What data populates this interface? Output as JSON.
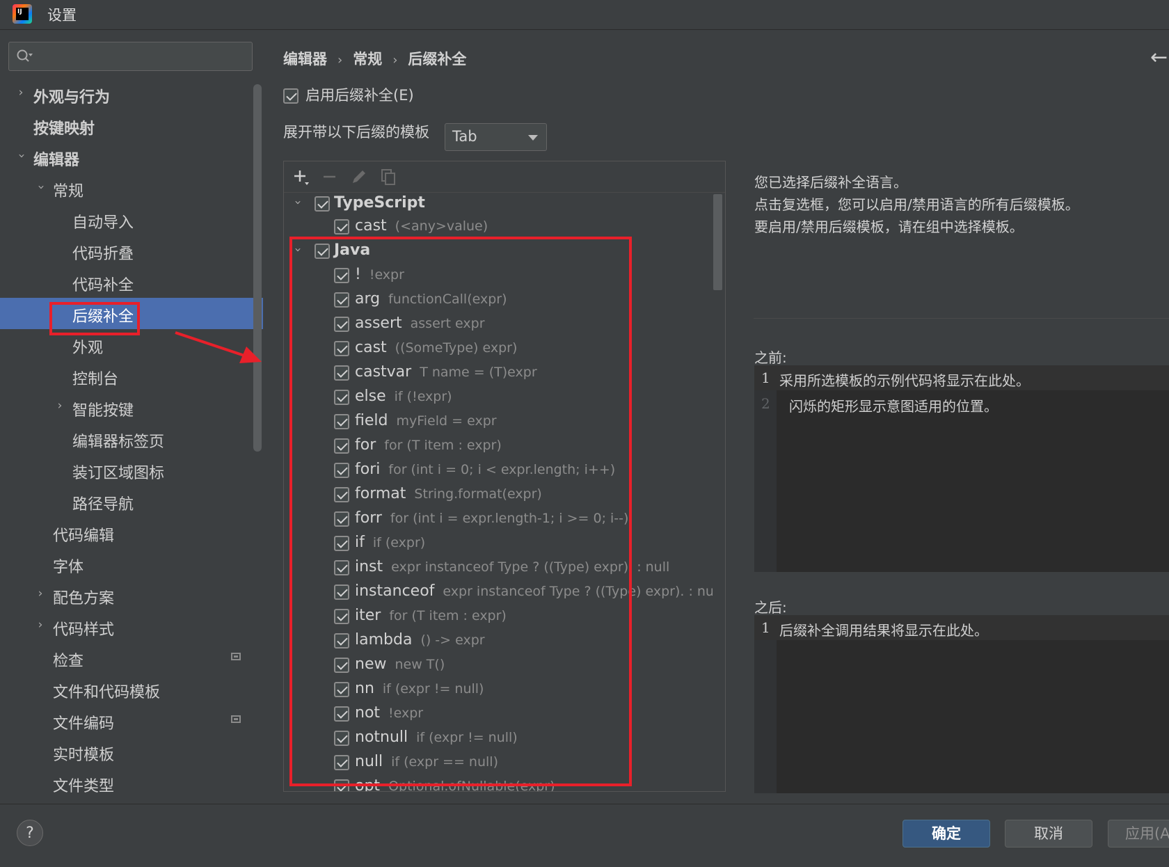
{
  "window": {
    "title": "设置"
  },
  "search": {
    "placeholder": ""
  },
  "sidebar": {
    "items": [
      {
        "label": "外观与行为"
      },
      {
        "label": "按键映射"
      },
      {
        "label": "编辑器"
      },
      {
        "label": "常规"
      },
      {
        "label": "自动导入"
      },
      {
        "label": "代码折叠"
      },
      {
        "label": "代码补全"
      },
      {
        "label": "后缀补全"
      },
      {
        "label": "外观"
      },
      {
        "label": "控制台"
      },
      {
        "label": "智能按键"
      },
      {
        "label": "编辑器标签页"
      },
      {
        "label": "装订区域图标"
      },
      {
        "label": "路径导航"
      },
      {
        "label": "代码编辑"
      },
      {
        "label": "字体"
      },
      {
        "label": "配色方案"
      },
      {
        "label": "代码样式"
      },
      {
        "label": "检查"
      },
      {
        "label": "文件和代码模板"
      },
      {
        "label": "文件编码"
      },
      {
        "label": "实时模板"
      },
      {
        "label": "文件类型"
      }
    ]
  },
  "breadcrumb": {
    "items": [
      "编辑器",
      "常规",
      "后缀补全"
    ]
  },
  "main": {
    "enable_label": "启用后缀补全(E)",
    "expand_label": "展开带以下后缀的模板",
    "expand_value": "Tab"
  },
  "templates": {
    "groups": [
      {
        "name": "TypeScript",
        "items": [
          {
            "key": "cast",
            "example": "(<any>value)"
          }
        ]
      },
      {
        "name": "Java",
        "items": [
          {
            "key": "!",
            "example": "!expr"
          },
          {
            "key": "arg",
            "example": "functionCall(expr)"
          },
          {
            "key": "assert",
            "example": "assert expr"
          },
          {
            "key": "cast",
            "example": "((SomeType) expr)"
          },
          {
            "key": "castvar",
            "example": "T name = (T)expr"
          },
          {
            "key": "else",
            "example": "if (!expr)"
          },
          {
            "key": "field",
            "example": "myField = expr"
          },
          {
            "key": "for",
            "example": "for (T item : expr)"
          },
          {
            "key": "fori",
            "example": "for (int i = 0; i < expr.length; i++)"
          },
          {
            "key": "format",
            "example": "String.format(expr)"
          },
          {
            "key": "forr",
            "example": "for (int i = expr.length-1; i >= 0; i--)"
          },
          {
            "key": "if",
            "example": "if (expr)"
          },
          {
            "key": "inst",
            "example": "expr instanceof Type ? ((Type) expr). : null"
          },
          {
            "key": "instanceof",
            "example": "expr instanceof Type ? ((Type) expr). : null"
          },
          {
            "key": "iter",
            "example": "for (T item : expr)"
          },
          {
            "key": "lambda",
            "example": "() -> expr"
          },
          {
            "key": "new",
            "example": "new T()"
          },
          {
            "key": "nn",
            "example": "if (expr != null)"
          },
          {
            "key": "not",
            "example": "!expr"
          },
          {
            "key": "notnull",
            "example": "if (expr != null)"
          },
          {
            "key": "null",
            "example": "if (expr == null)"
          },
          {
            "key": "opt",
            "example": "Optional.ofNullable(expr)"
          }
        ]
      }
    ]
  },
  "description": {
    "lines": [
      "您已选择后缀补全语言。",
      "点击复选框，您可以启用/禁用语言的所有后缀模板。",
      "要启用/禁用后缀模板，请在组中选择模板。"
    ]
  },
  "before": {
    "label": "之前:",
    "lines": [
      {
        "num": "1",
        "text": "采用所选模板的示例代码将显示在此处。"
      },
      {
        "num": "2",
        "text": "闪烁的矩形显示意图适用的位置。"
      }
    ]
  },
  "after": {
    "label": "之后:",
    "lines": [
      {
        "num": "1",
        "text": "后缀补全调用结果将显示在此处。"
      }
    ]
  },
  "footer": {
    "help": "?",
    "ok": "确定",
    "cancel": "取消",
    "apply": "应用(A"
  },
  "icons": {
    "logo": "intellij-logo",
    "search": "search-icon",
    "add": "plus-icon",
    "remove": "minus-icon",
    "edit": "pencil-icon",
    "copy": "copy-icon",
    "back": "back-arrow-icon"
  },
  "colors": {
    "selection": "#4b6eaf",
    "annotation": "#e8202a",
    "ok_button": "#365880"
  }
}
